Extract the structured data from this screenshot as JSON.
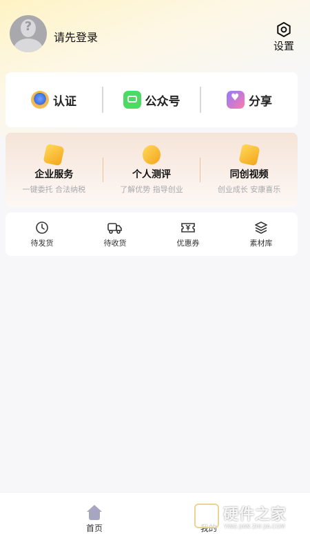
{
  "header": {
    "login_text": "请先登录",
    "settings_label": "设置"
  },
  "quick_actions": [
    {
      "label": "认证",
      "icon": "certification-badge-icon"
    },
    {
      "label": "公众号",
      "icon": "wechat-official-account-icon"
    },
    {
      "label": "分享",
      "icon": "share-icon"
    }
  ],
  "services": [
    {
      "title": "企业服务",
      "subtitle": "一键委托 合法纳税",
      "icon": "enterprise-service-icon"
    },
    {
      "title": "个人测评",
      "subtitle": "了解优势 指导创业",
      "icon": "personal-assessment-icon"
    },
    {
      "title": "同创视频",
      "subtitle": "创业成长 安康喜乐",
      "icon": "video-icon"
    }
  ],
  "orders": [
    {
      "label": "待发货",
      "icon": "clock-icon"
    },
    {
      "label": "待收货",
      "icon": "truck-icon"
    },
    {
      "label": "优惠券",
      "icon": "coupon-icon"
    },
    {
      "label": "素材库",
      "icon": "layers-icon"
    }
  ],
  "tabbar": {
    "home_label": "首页",
    "mine_label": "我的"
  },
  "watermark": {
    "title": "硬件之家",
    "subtitle": "YING JIAN ZHI JIA.COM"
  },
  "colors": {
    "accent_gold": "#f3a51c",
    "tab_icon": "#a6a6c0"
  }
}
